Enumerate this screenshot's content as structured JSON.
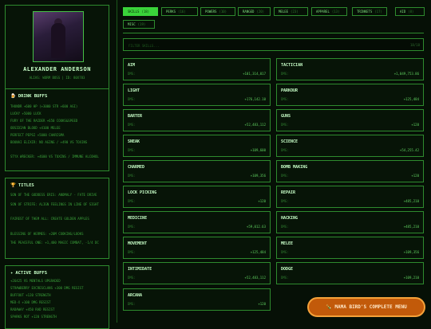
{
  "profile": {
    "name": "ALEXANDER ANDERSON",
    "alias": "ALIAS: WORM BOSS | ID: 80X783"
  },
  "drink_buffs": {
    "title": "DRINK BUFFS",
    "items": [
      "THUNDR +600 HP (+3000 STR +600 AGI)",
      "LUCKY +5000 LUCK",
      "FURY OF THE RAIDER +650 COOKS&SPEED",
      "OBSIDIAN BLOOD +4100 MELEE",
      "PERFECT PEPSI +5000 CHARISMA",
      "BOUNAI ELIXIR: NO AGING / +490 VS TOXINS",
      "STYX WRECKER: +4600 VS TOXINS / IMMUNE ALCOHOL"
    ]
  },
  "titles": {
    "title": "TITLES",
    "items": [
      "SON OF THE GODDESS ERIS: ANOMALY - FATE DRIVE",
      "SON OF STRIFE: ALIGN FEELINGS IN LINE OF SIGHT",
      "FAIREST OF THEM ALL: CREATE GOLDEN APPLES",
      "BLESSING OF HERMES: +20M COOKING/LOOKS",
      "THE PEACEFUL ONE: +1,400 MAGIC COMBAT, -1/4 DC"
    ]
  },
  "active_buffs": {
    "title": "ACTIVE BUFFS",
    "items": [
      "+26425 VS MENTALS UPGRADED",
      "STRAWBERRY EXCRESCLANS +300 DMG RESIST",
      "BUFFOUT +120 STRENGTH",
      "MED-X +100 DMG RESIST",
      "RADAWAY +450 RAD RESIST",
      "SPARKS ROT +120 STRENGTH"
    ]
  },
  "tabs": [
    {
      "label": "SKILLS",
      "count": "(18)"
    },
    {
      "label": "PERKS",
      "count": "(16)"
    },
    {
      "label": "POWERS",
      "count": "(10)"
    },
    {
      "label": "RANGED",
      "count": "(20)"
    },
    {
      "label": "MELEE",
      "count": "(23)"
    },
    {
      "label": "APPAREL",
      "count": "(13)"
    },
    {
      "label": "TRINKETS",
      "count": "(17)"
    },
    {
      "label": "AID",
      "count": "(8)"
    },
    {
      "label": "MISC",
      "count": "(19)"
    }
  ],
  "filter": {
    "placeholder": "FILTER SKILLS...",
    "count": "18/18"
  },
  "dmg_label": "DMG:",
  "skills": [
    {
      "name": "AIM",
      "value": "+101,314,017"
    },
    {
      "name": "TACTICIAN",
      "value": "+1,049,753.86"
    },
    {
      "name": "LIGHT",
      "value": "+176,142.10"
    },
    {
      "name": "PARKOUR",
      "value": "+125,484"
    },
    {
      "name": "BARTER",
      "value": "+52,483,112"
    },
    {
      "name": "GUNS",
      "value": "+120"
    },
    {
      "name": "SNEAK",
      "value": "+109,600"
    },
    {
      "name": "SCIENCE",
      "value": "+54,255.42"
    },
    {
      "name": "CHARMED",
      "value": "+109,356"
    },
    {
      "name": "BOMB MAKING",
      "value": "+120"
    },
    {
      "name": "LOCK PICKING",
      "value": "+120"
    },
    {
      "name": "REPAIR",
      "value": "+485,210"
    },
    {
      "name": "MEDICINE",
      "value": "+59,012.63"
    },
    {
      "name": "HACKING",
      "value": "+485,210"
    },
    {
      "name": "MOVEMENT",
      "value": "+125,484"
    },
    {
      "name": "MELEE",
      "value": "+109,356"
    },
    {
      "name": "INTIMIDATE",
      "value": "+52,483,112"
    },
    {
      "name": "DODGE",
      "value": "+109,210"
    },
    {
      "name": "ARCANA",
      "value": "+120"
    }
  ],
  "menu_button": "MAMA BIRD'S COMPLETE MENU",
  "colors": {
    "accent": "#3ad43a",
    "border": "#2e8b2e",
    "menu": "#c25a0a"
  }
}
